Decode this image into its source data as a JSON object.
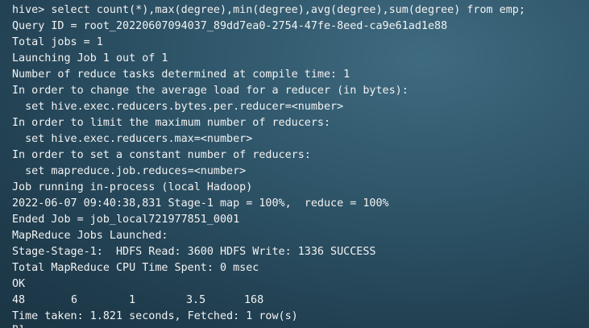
{
  "terminal": {
    "lines": [
      "hive> select count(*),max(degree),min(degree),avg(degree),sum(degree) from emp;",
      "Query ID = root_20220607094037_89dd7ea0-2754-47fe-8eed-ca9e61ad1e88",
      "Total jobs = 1",
      "Launching Job 1 out of 1",
      "Number of reduce tasks determined at compile time: 1",
      "In order to change the average load for a reducer (in bytes):",
      "  set hive.exec.reducers.bytes.per.reducer=<number>",
      "In order to limit the maximum number of reducers:",
      "  set hive.exec.reducers.max=<number>",
      "In order to set a constant number of reducers:",
      "  set mapreduce.job.reduces=<number>",
      "Job running in-process (local Hadoop)",
      "2022-06-07 09:40:38,831 Stage-1 map = 100%,  reduce = 100%",
      "Ended Job = job_local721977851_0001",
      "MapReduce Jobs Launched:",
      "Stage-Stage-1:  HDFS Read: 3600 HDFS Write: 1336 SUCCESS",
      "Total MapReduce CPU Time Spent: 0 msec",
      "OK"
    ],
    "result_row": [
      "48",
      "6",
      "1",
      "3.5",
      "168"
    ],
    "footer": "Time taken: 1.821 seconds, Fetched: 1 row(s)",
    "next_prompt_partial": "hi"
  }
}
